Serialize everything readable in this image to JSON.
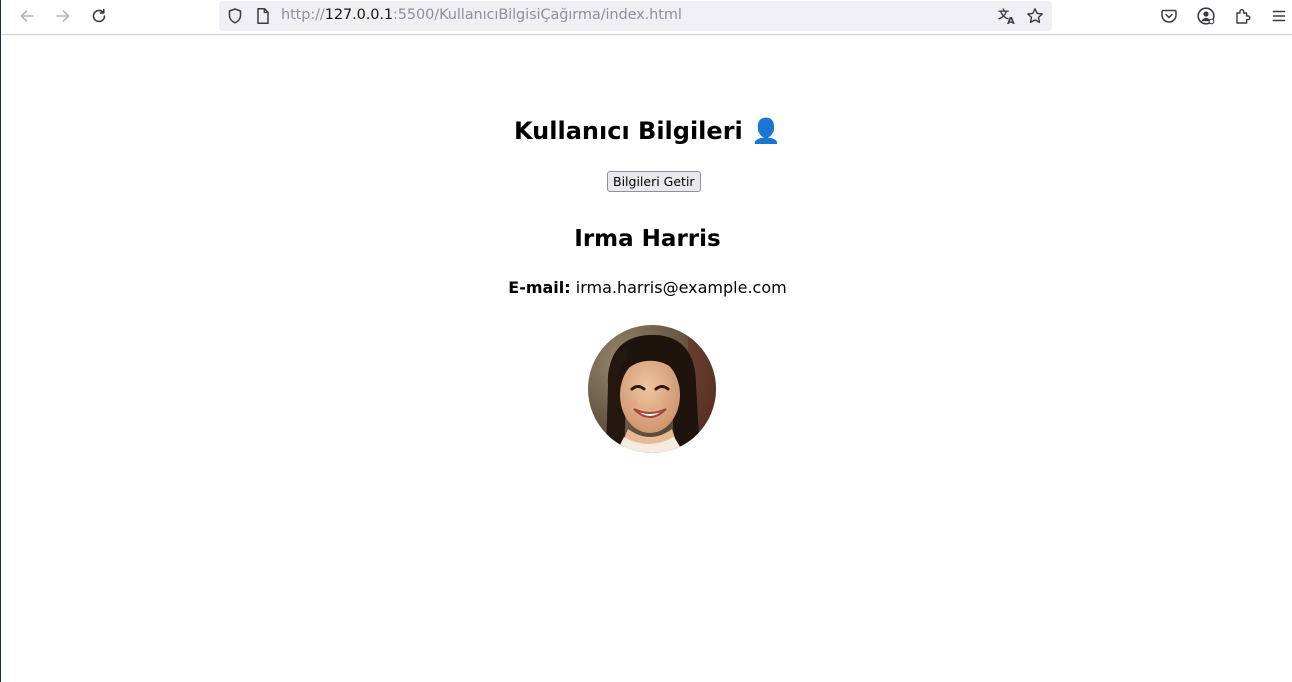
{
  "browser": {
    "url_prefix": "http://",
    "url_host": "127.0.0.1",
    "url_rest": ":5500/KullanıcıBilgisiÇağırma/index.html"
  },
  "page": {
    "title": "Kullanıcı Bilgileri",
    "title_emoji": "👤",
    "fetch_button_label": "Bilgileri Getir",
    "user": {
      "name": "Irma Harris",
      "email_label": "E-mail:",
      "email": "irma.harris@example.com"
    }
  },
  "colors": {
    "accent_icon": "#2b6fd6",
    "toolbar_icon": "#5b5b66",
    "urlbar_bg": "#f0f0f4"
  }
}
